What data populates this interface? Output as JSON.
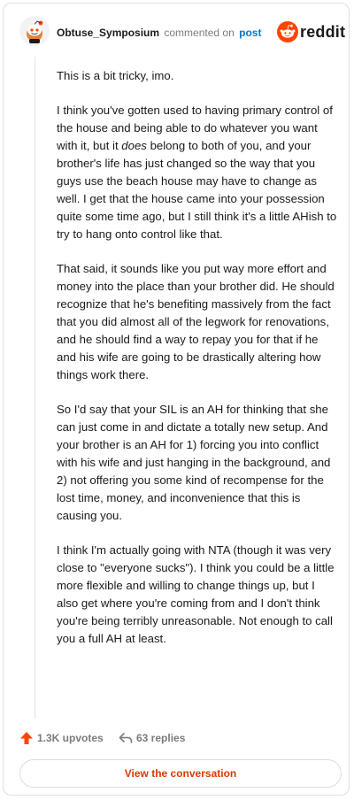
{
  "header": {
    "username": "Obtuse_Symposium",
    "verb": "commented on",
    "post_link": "post",
    "brand": "reddit"
  },
  "comment": {
    "paragraphs": [
      "This is a bit tricky, imo.",
      "I think you've gotten used to having primary control of the house and being able to do whatever you want with it, but it does belong to both of you, and your brother's life has just changed so the way that you guys use the beach house may have to change as well. I get that the house came into your possession quite some time ago, but I still think it's a little AHish to try to hang onto control like that.",
      "That said, it sounds like you put way more effort and money into the place than your brother did. He should recognize that he's benefiting massively from the fact that you did almost all of the legwork for renovations, and he should find a way to repay you for that if he and his wife are going to be drastically altering how things work there.",
      "So I'd say that your SIL is an AH for thinking that she can just come in and dictate a totally new setup. And your brother is an AH for 1) forcing you into conflict with his wife and just hanging in the background, and 2) not offering you some kind of recompense for the lost time, money, and inconvenience that this is causing you.",
      "I think I'm actually going with NTA (though it was very close to \"everyone sucks\"). I think you could be a little more flexible and willing to change things up, but I also get where you're coming from and I don't think you're being terribly unreasonable. Not enough to call you a full AH at least."
    ]
  },
  "footer": {
    "upvotes": "1.3K upvotes",
    "replies": "63 replies",
    "view_button": "View the conversation"
  },
  "colors": {
    "reddit_orange": "#ff4500",
    "link_blue": "#0079d3",
    "button_text": "#d93a00"
  },
  "icons": [
    "snoo-avatar-icon",
    "reddit-logo-icon",
    "upvote-arrow-icon",
    "reply-arrow-icon"
  ]
}
